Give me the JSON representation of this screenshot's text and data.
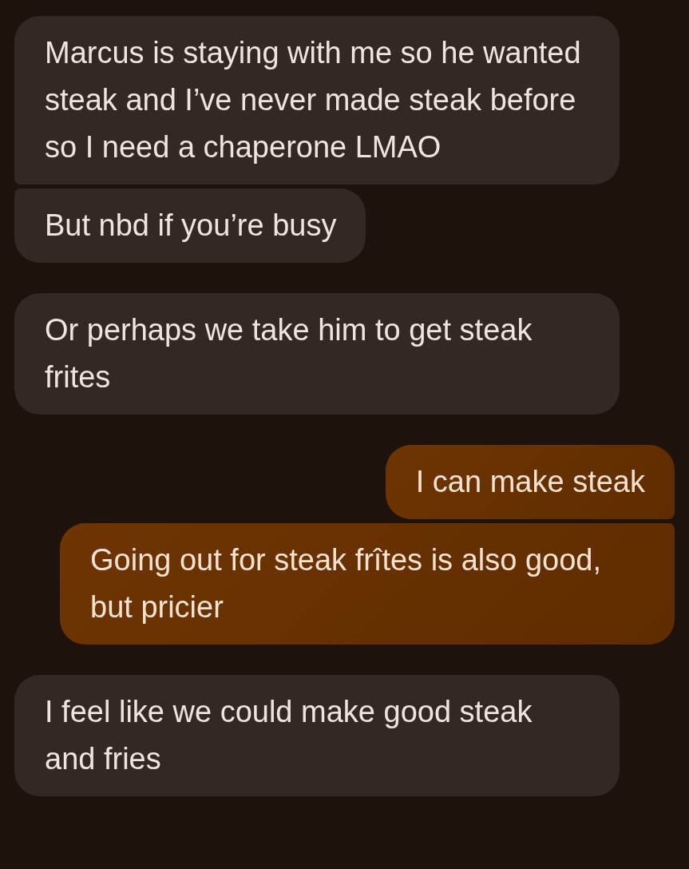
{
  "groups": [
    {
      "kind": "incoming",
      "messages": [
        "Marcus is staying with me so he wanted steak and I’ve never made steak before so I need a chaperone LMAO",
        "But nbd if you’re busy"
      ]
    },
    {
      "kind": "incoming",
      "messages": [
        "Or perhaps we take him to get steak frites"
      ]
    },
    {
      "kind": "outgoing",
      "messages": [
        "I can make steak",
        "Going out for steak frîtes is also good, but pricier"
      ]
    },
    {
      "kind": "incoming",
      "messages": [
        "I feel like we could make good steak and fries"
      ]
    }
  ]
}
